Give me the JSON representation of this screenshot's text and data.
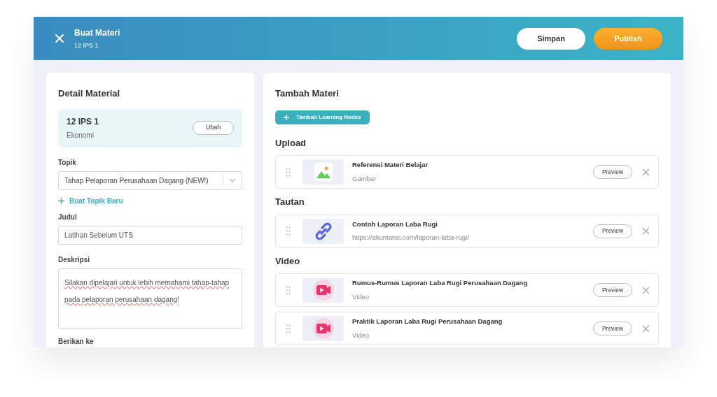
{
  "header": {
    "title": "Buat Materi",
    "subtitle": "12 IPS 1",
    "buttons": [
      {
        "label": "Simpan",
        "kind": "secondary"
      },
      {
        "label": "Publish",
        "kind": "primary"
      }
    ]
  },
  "detail": {
    "title": "Detail Material",
    "class_card": {
      "name": "12 IPS 1",
      "subject": "Ekonomi",
      "button": "Ubah"
    },
    "topic": {
      "label": "Topik",
      "value": "Tahap Pelaporan Perusahaan Dagang (NEW!)"
    },
    "new_topic_link": "Buat Topik Baru",
    "title_field": {
      "label": "Judul",
      "value": "Latihan Sebelum UTS"
    },
    "description": {
      "label": "Deskripsi",
      "value": "Silakan dipelajari untuk lebih memahami tahap-tahap pada pelaporan perusahaan dagang!"
    },
    "assign": {
      "label": "Berikan ke"
    }
  },
  "materials": {
    "title": "Tambah Materi",
    "add_button": "Tambah Learning Nodes",
    "sections": [
      {
        "title": "Upload",
        "items": [
          {
            "kind": "image",
            "title": "Referensi Materi Belajar",
            "subtitle": "Gambar",
            "button": "Preview"
          }
        ]
      },
      {
        "title": "Tautan",
        "items": [
          {
            "kind": "link",
            "title": "Contoh Laporan Laba Rugi",
            "subtitle": "https://akuntansi.com/laporan-laba-rugi/",
            "button": "Preview"
          }
        ]
      },
      {
        "title": "Video",
        "items": [
          {
            "kind": "video",
            "title": "Rumus-Rumus Laporan Laba Rugi Perusahaan Dagang",
            "subtitle": "Video",
            "button": "Preview"
          },
          {
            "kind": "video",
            "title": "Praktik Laporan Laba Rugi Perusahaan Dagang",
            "subtitle": "Video",
            "button": "Preview"
          }
        ]
      }
    ]
  }
}
